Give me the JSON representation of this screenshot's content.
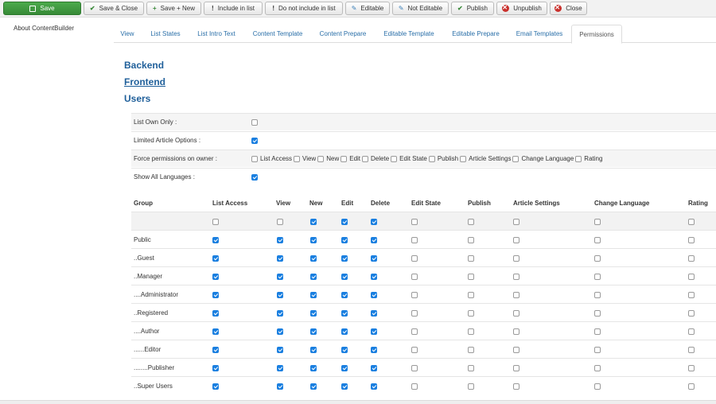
{
  "toolbar": {
    "buttons": [
      {
        "label": "Save",
        "icon": "save-icon"
      },
      {
        "label": "Save & Close",
        "icon": "check-icon"
      },
      {
        "label": "Save + New",
        "icon": "plus-icon"
      },
      {
        "label": "Include in list",
        "icon": "exclamation-icon"
      },
      {
        "label": "Do not include in list",
        "icon": "exclamation-icon"
      },
      {
        "label": "Editable",
        "icon": "edit-icon"
      },
      {
        "label": "Not Editable",
        "icon": "edit-icon"
      },
      {
        "label": "Publish",
        "icon": "check-icon"
      },
      {
        "label": "Unpublish",
        "icon": "x-circle-icon"
      },
      {
        "label": "Close",
        "icon": "x-circle-icon"
      }
    ]
  },
  "sidebar": {
    "about": "About ContentBuilder"
  },
  "tabs": [
    {
      "label": "View"
    },
    {
      "label": "List States"
    },
    {
      "label": "List Intro Text"
    },
    {
      "label": "Content Template"
    },
    {
      "label": "Content Prepare"
    },
    {
      "label": "Editable Template"
    },
    {
      "label": "Editable Prepare"
    },
    {
      "label": "Email Templates"
    },
    {
      "label": "Permissions",
      "active": true
    }
  ],
  "sections": {
    "backend": "Backend",
    "frontend": "Frontend",
    "users": "Users"
  },
  "options": {
    "list_own_only": {
      "label": "List Own Only :",
      "checked": false
    },
    "limited_article": {
      "label": "Limited Article Options :",
      "checked": true
    },
    "force_permissions": {
      "label": "Force permissions on owner :",
      "items": [
        {
          "label": "List Access",
          "checked": false
        },
        {
          "label": "View",
          "checked": false
        },
        {
          "label": "New",
          "checked": false
        },
        {
          "label": "Edit",
          "checked": false
        },
        {
          "label": "Delete",
          "checked": false
        },
        {
          "label": "Edit State",
          "checked": false
        },
        {
          "label": "Publish",
          "checked": false
        },
        {
          "label": "Article Settings",
          "checked": false
        },
        {
          "label": "Change Language",
          "checked": false
        },
        {
          "label": "Rating",
          "checked": false
        }
      ]
    },
    "show_all_languages": {
      "label": "Show All Languages :",
      "checked": true
    }
  },
  "grid": {
    "group_header": "Group",
    "columns": [
      "List Access",
      "View",
      "New",
      "Edit",
      "Delete",
      "Edit State",
      "Publish",
      "Article Settings",
      "Change Language",
      "Rating"
    ],
    "toggle_row": [
      false,
      false,
      true,
      true,
      true,
      false,
      false,
      false,
      false,
      false
    ],
    "rows": [
      {
        "name": "Public",
        "values": [
          true,
          true,
          true,
          true,
          true,
          false,
          false,
          false,
          false,
          false
        ]
      },
      {
        "name": "..Guest",
        "values": [
          true,
          true,
          true,
          true,
          true,
          false,
          false,
          false,
          false,
          false
        ]
      },
      {
        "name": "..Manager",
        "values": [
          true,
          true,
          true,
          true,
          true,
          false,
          false,
          false,
          false,
          false
        ]
      },
      {
        "name": "....Administrator",
        "values": [
          true,
          true,
          true,
          true,
          true,
          false,
          false,
          false,
          false,
          false
        ]
      },
      {
        "name": "..Registered",
        "values": [
          true,
          true,
          true,
          true,
          true,
          false,
          false,
          false,
          false,
          false
        ]
      },
      {
        "name": "....Author",
        "values": [
          true,
          true,
          true,
          true,
          true,
          false,
          false,
          false,
          false,
          false
        ]
      },
      {
        "name": "......Editor",
        "values": [
          true,
          true,
          true,
          true,
          true,
          false,
          false,
          false,
          false,
          false
        ]
      },
      {
        "name": "........Publisher",
        "values": [
          true,
          true,
          true,
          true,
          true,
          false,
          false,
          false,
          false,
          false
        ]
      },
      {
        "name": "..Super Users",
        "values": [
          true,
          true,
          true,
          true,
          true,
          false,
          false,
          false,
          false,
          false
        ]
      }
    ]
  },
  "colors": {
    "accent": "#1a7fe0",
    "link": "#2a6fa8",
    "save_button": "#3f9a3f",
    "danger": "#c9302c"
  }
}
